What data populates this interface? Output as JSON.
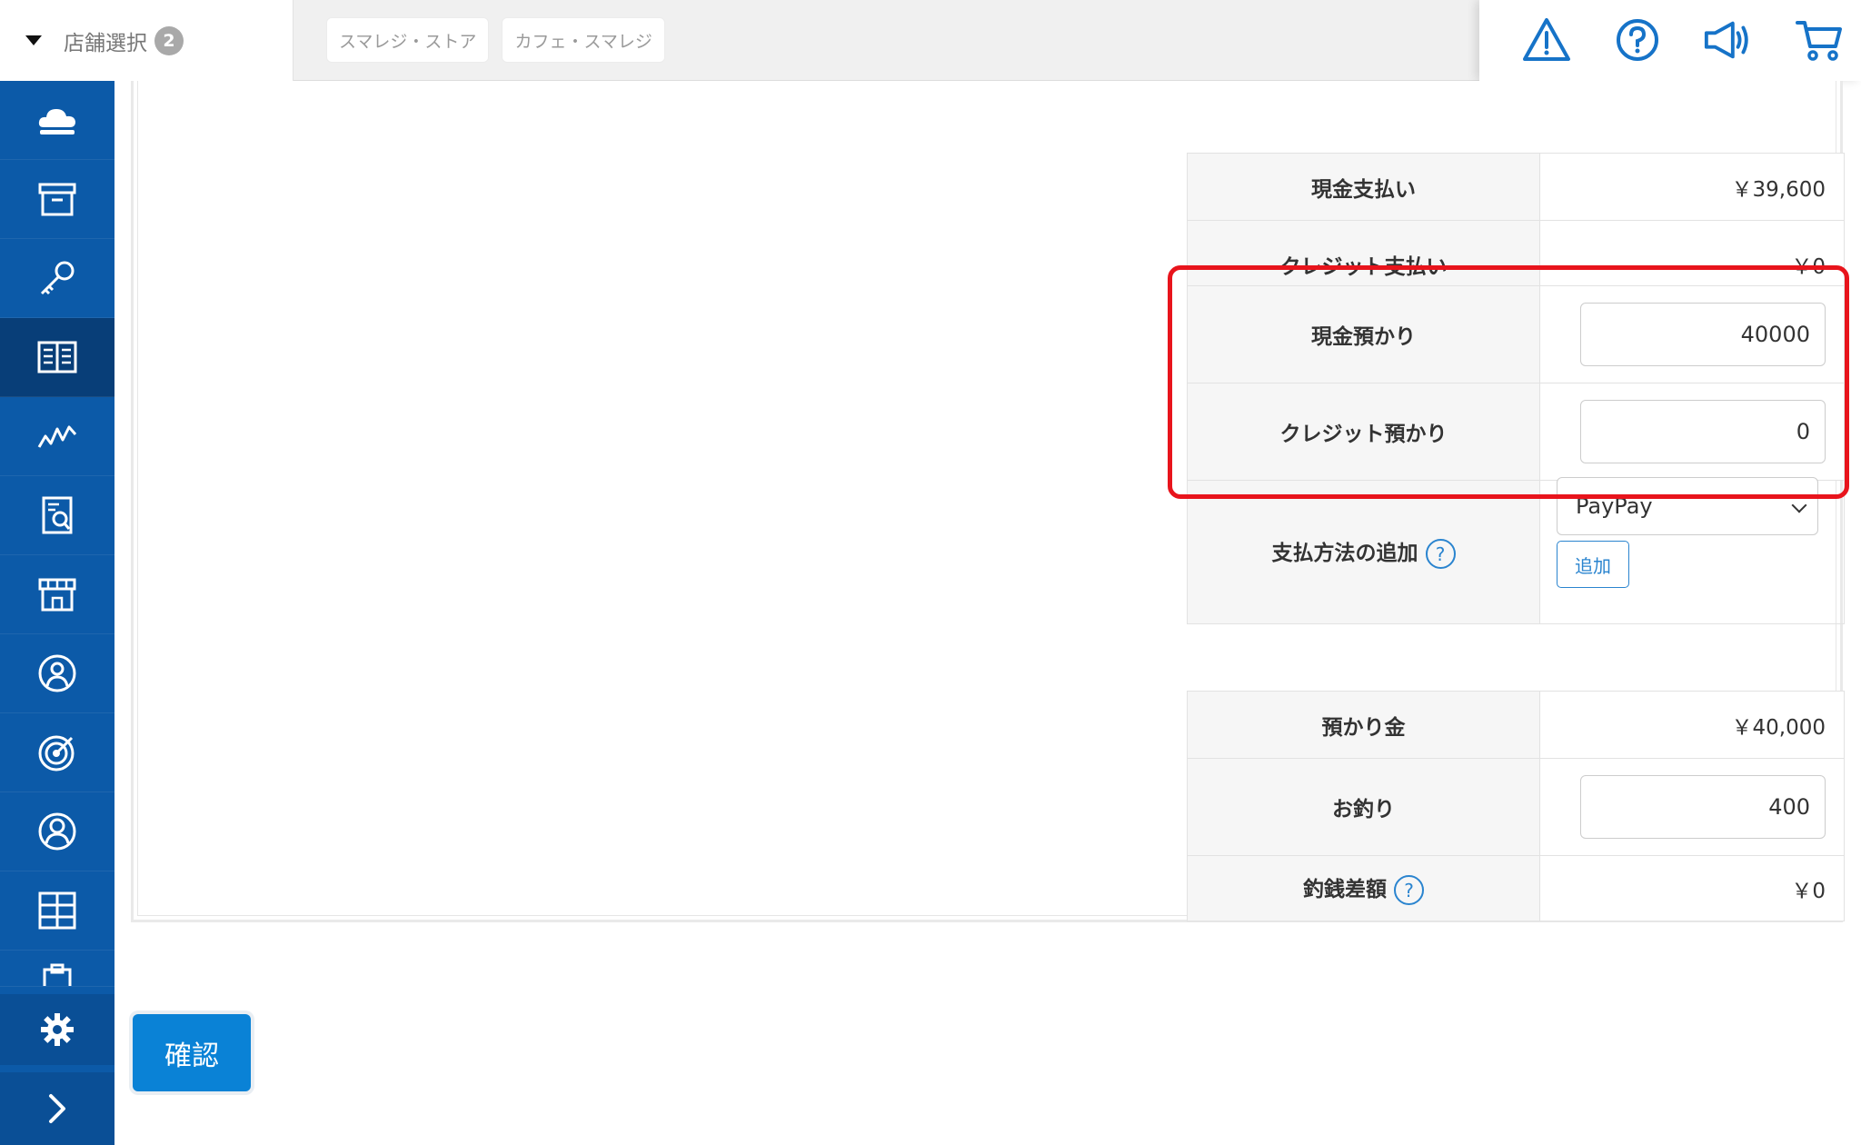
{
  "header": {
    "store_select_label": "店舗選択",
    "store_count": "2",
    "store_chips": [
      "スマレジ・ストア",
      "カフェ・スマレジ"
    ],
    "icons": [
      "warning-icon",
      "help-icon",
      "megaphone-icon",
      "cart-icon"
    ]
  },
  "sidebar": {
    "items": [
      "cloud-icon",
      "archive-icon",
      "key-icon",
      "book-icon",
      "chart-line-icon",
      "report-icon",
      "store-icon",
      "customer-icon",
      "target-icon",
      "user-icon",
      "layout-icon",
      "clipboard-icon"
    ],
    "active_index": 3,
    "settings_icon": "gear-icon",
    "expand_icon": "chevron-right-icon"
  },
  "payment": {
    "cash_payment_label": "現金支払い",
    "cash_payment_value": "￥39,600",
    "credit_payment_label": "クレジット支払い",
    "credit_payment_value": "￥0",
    "cash_deposit_label": "現金預かり",
    "cash_deposit_value": "40000",
    "credit_deposit_label": "クレジット預かり",
    "credit_deposit_value": "0",
    "add_method_label": "支払方法の追加",
    "add_method_select": "PayPay",
    "add_button": "追加",
    "help_mark": "?"
  },
  "summary": {
    "deposit_label": "預かり金",
    "deposit_value": "￥40,000",
    "change_label": "お釣り",
    "change_value": "400",
    "diff_label": "釣銭差額",
    "diff_value": "￥0"
  },
  "actions": {
    "confirm_button": "確認"
  },
  "colors": {
    "sidebar": "#0c5aa8",
    "accent": "#0a82d6",
    "highlight": "#e8141c"
  }
}
